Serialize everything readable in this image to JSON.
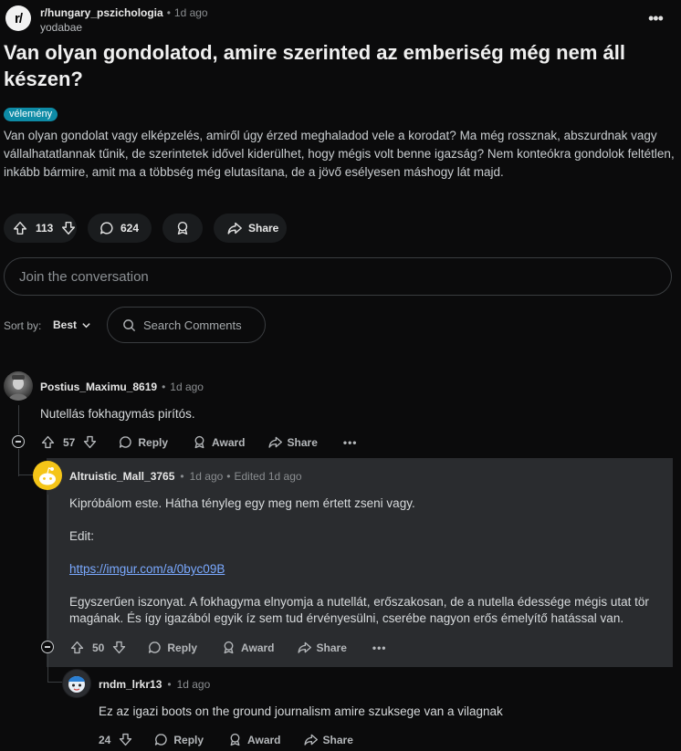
{
  "post": {
    "subreddit": "r/hungary_pszichologia",
    "time": "1d ago",
    "author": "yodabae",
    "title": "Van olyan gondolatod, amire szerinted az emberiség még nem áll készen?",
    "flair": "vélemény",
    "body": "Van olyan gondolat vagy elképzelés, amiről úgy érzed meghaladod vele a korodat? Ma még rossznak, abszurdnak vagy vállalhatatlannak tűnik, de szerintetek idővel kiderülhet, hogy mégis volt benne igazság? Nem konteókra gondolok feltétlen, inkább bármire, amit ma a többség még elutasítana, de a jövő esélyesen máshogy lát majd.",
    "votes": "113",
    "comments_count": "624",
    "share_label": "Share"
  },
  "join_placeholder": "Join the conversation",
  "sort": {
    "label": "Sort by:",
    "value": "Best"
  },
  "search_placeholder": "Search Comments",
  "actions": {
    "reply": "Reply",
    "award": "Award",
    "share": "Share"
  },
  "comments": [
    {
      "user": "Postius_Maximu_8619",
      "time": "1d ago",
      "text": "Nutellás fokhagymás pirítós.",
      "votes": "57"
    },
    {
      "user": "Altruistic_Mall_3765",
      "time": "1d ago",
      "edited": "Edited 1d ago",
      "line1": "Kipróbálom este. Hátha tényleg egy meg nem értett zseni vagy.",
      "line2": "Edit:",
      "link": "https://imgur.com/a/0byc09B",
      "line3": "Egyszerűen iszonyat. A fokhagyma elnyomja a nutellát, erőszakosan, de a nutella édessége mégis utat tör magának. És így igazából egyik íz sem tud érvényesülni, cserébe nagyon erős émelyítő hatással van.",
      "votes": "50"
    },
    {
      "user": "rndm_lrkr13",
      "time": "1d ago",
      "text": "Ez az igazi boots on the ground journalism amire szuksege van a vilagnak",
      "votes": "24"
    }
  ]
}
